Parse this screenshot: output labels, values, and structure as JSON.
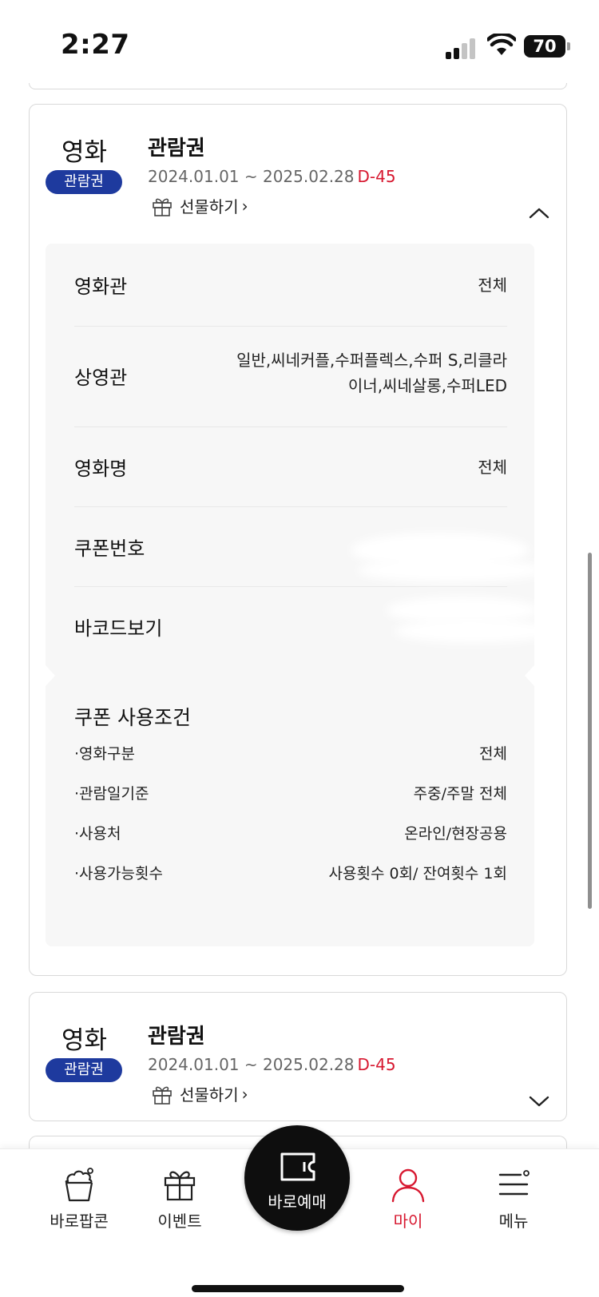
{
  "status_bar": {
    "time": "2:27",
    "battery": "70"
  },
  "coupons": [
    {
      "category": "영화",
      "badge": "관람권",
      "title": "관람권",
      "period": "2024.01.01 ~ 2025.02.28",
      "dday": "D-45",
      "gift_label": "선물하기",
      "expanded": true,
      "details": [
        {
          "key": "영화관",
          "value": "전체"
        },
        {
          "key": "상영관",
          "value_line1": "일반,씨네커플,수퍼플렉스,수퍼 S,리클라",
          "value_line2": "이너,씨네살롱,수퍼LED"
        },
        {
          "key": "영화명",
          "value": "전체"
        },
        {
          "key": "쿠폰번호"
        },
        {
          "key": "바코드보기"
        }
      ],
      "conditions_title": "쿠폰 사용조건",
      "conditions": [
        {
          "key": "·영화구분",
          "value": "전체"
        },
        {
          "key": "·관람일기준",
          "value": "주중/주말 전체"
        },
        {
          "key": "·사용처",
          "value": "온라인/현장공용"
        },
        {
          "key": "·사용가능횟수",
          "value": "사용횟수 0회/ 잔여횟수 1회"
        }
      ]
    },
    {
      "category": "영화",
      "badge": "관람권",
      "title": "관람권",
      "period": "2024.01.01 ~ 2025.02.28",
      "dday": "D-45",
      "gift_label": "선물하기",
      "expanded": false
    }
  ],
  "bottom_nav": {
    "items": [
      {
        "label": "바로팝콘",
        "icon": "popcorn-icon"
      },
      {
        "label": "이벤트",
        "icon": "gift-icon"
      },
      {
        "label": "마이",
        "icon": "person-icon",
        "active": true
      },
      {
        "label": "메뉴",
        "icon": "menu-icon"
      }
    ],
    "center": {
      "label": "바로예매",
      "icon": "ticket-icon"
    }
  },
  "colors": {
    "accent": "#d7172f",
    "badge": "#1e3a9e",
    "dark": "#0e0e0e"
  }
}
